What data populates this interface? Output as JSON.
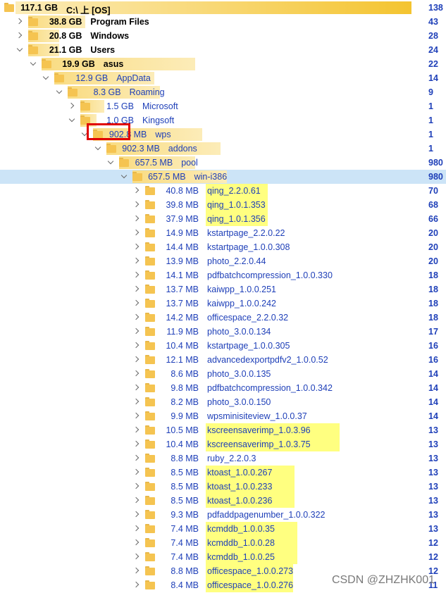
{
  "colors": {
    "bar": "#f9dc83",
    "bar_fade": "#fcecb8",
    "selection": "#cce4f7",
    "highlight": "#ffff80",
    "text_blue": "#1e3fb8",
    "annotation_red": "#e00000"
  },
  "icons": {
    "folder": "folder-icon",
    "expand": "chevron-right-icon",
    "collapse": "chevron-down-icon"
  },
  "watermark": "CSDN @ZHZHK001",
  "rows": [
    {
      "size": "117.1 GB",
      "name": "C:\\  上  [OS]",
      "right": "138",
      "depth": 0,
      "expanded": true,
      "bold": true,
      "bar": 1.0
    },
    {
      "size": "38.8 GB",
      "name": "Program Files",
      "right": "43",
      "depth": 1,
      "expanded": false,
      "bold": true,
      "bar": 0.33
    },
    {
      "size": "20.8 GB",
      "name": "Windows",
      "right": "28",
      "depth": 1,
      "expanded": false,
      "bold": true,
      "bar": 0.18
    },
    {
      "size": "21.1 GB",
      "name": "Users",
      "right": "24",
      "depth": 1,
      "expanded": true,
      "bold": true,
      "bar": 0.18
    },
    {
      "size": "19.9 GB",
      "name": "asus",
      "right": "22",
      "depth": 2,
      "expanded": true,
      "bold": true,
      "bar": 0.94
    },
    {
      "size": "12.9 GB",
      "name": "AppData",
      "right": "14",
      "depth": 3,
      "expanded": true,
      "bold": false,
      "bar": 0.65
    },
    {
      "size": "8.3 GB",
      "name": "Roaming",
      "right": "9",
      "depth": 4,
      "expanded": true,
      "bold": false,
      "bar": 0.64
    },
    {
      "size": "1.5 GB",
      "name": "Microsoft",
      "right": "1",
      "depth": 5,
      "expanded": false,
      "bold": false,
      "bar": 0.18
    },
    {
      "size": "1.0 GB",
      "name": "Kingsoft",
      "right": "1",
      "depth": 5,
      "expanded": true,
      "bold": false,
      "bar": 0.12
    },
    {
      "size": "902.8 MB",
      "name": "wps",
      "right": "1",
      "depth": 6,
      "expanded": true,
      "bold": false,
      "bar": 0.88
    },
    {
      "size": "902.3 MB",
      "name": "addons",
      "right": "1",
      "depth": 7,
      "expanded": true,
      "bold": false,
      "bar": 1.0
    },
    {
      "size": "657.5 MB",
      "name": "pool",
      "right": "980",
      "depth": 8,
      "expanded": true,
      "bold": false,
      "bar": 0.73
    },
    {
      "size": "657.5 MB",
      "name": "win-i386",
      "right": "980",
      "depth": 9,
      "expanded": true,
      "bold": false,
      "bar": 1.0,
      "selected": true
    },
    {
      "size": "40.8 MB",
      "name": "qing_2.2.0.61",
      "right": "70",
      "depth": 10,
      "expanded": false,
      "bar": 0,
      "hl": 88
    },
    {
      "size": "39.8 MB",
      "name": "qing_1.0.1.353",
      "right": "68",
      "depth": 10,
      "expanded": false,
      "bar": 0,
      "hl": 88
    },
    {
      "size": "37.9 MB",
      "name": "qing_1.0.1.356",
      "right": "66",
      "depth": 10,
      "expanded": false,
      "bar": 0,
      "hl": 88
    },
    {
      "size": "14.9 MB",
      "name": "kstartpage_2.2.0.22",
      "right": "20",
      "depth": 10,
      "expanded": false,
      "bar": 0
    },
    {
      "size": "14.4 MB",
      "name": "kstartpage_1.0.0.308",
      "right": "20",
      "depth": 10,
      "expanded": false,
      "bar": 0
    },
    {
      "size": "13.9 MB",
      "name": "photo_2.2.0.44",
      "right": "20",
      "depth": 10,
      "expanded": false,
      "bar": 0
    },
    {
      "size": "14.1 MB",
      "name": "pdfbatchcompression_1.0.0.330",
      "right": "18",
      "depth": 10,
      "expanded": false,
      "bar": 0
    },
    {
      "size": "13.7 MB",
      "name": "kaiwpp_1.0.0.251",
      "right": "18",
      "depth": 10,
      "expanded": false,
      "bar": 0
    },
    {
      "size": "13.7 MB",
      "name": "kaiwpp_1.0.0.242",
      "right": "18",
      "depth": 10,
      "expanded": false,
      "bar": 0
    },
    {
      "size": "14.2 MB",
      "name": "officespace_2.2.0.32",
      "right": "18",
      "depth": 10,
      "expanded": false,
      "bar": 0
    },
    {
      "size": "11.9 MB",
      "name": "photo_3.0.0.134",
      "right": "17",
      "depth": 10,
      "expanded": false,
      "bar": 0
    },
    {
      "size": "10.4 MB",
      "name": "kstartpage_1.0.0.305",
      "right": "16",
      "depth": 10,
      "expanded": false,
      "bar": 0
    },
    {
      "size": "12.1 MB",
      "name": "advancedexportpdfv2_1.0.0.52",
      "right": "16",
      "depth": 10,
      "expanded": false,
      "bar": 0
    },
    {
      "size": "8.6 MB",
      "name": "photo_3.0.0.135",
      "right": "14",
      "depth": 10,
      "expanded": false,
      "bar": 0
    },
    {
      "size": "9.8 MB",
      "name": "pdfbatchcompression_1.0.0.342",
      "right": "14",
      "depth": 10,
      "expanded": false,
      "bar": 0
    },
    {
      "size": "8.2 MB",
      "name": "photo_3.0.0.150",
      "right": "14",
      "depth": 10,
      "expanded": false,
      "bar": 0
    },
    {
      "size": "9.9 MB",
      "name": "wpsminisiteview_1.0.0.37",
      "right": "14",
      "depth": 10,
      "expanded": false,
      "bar": 0
    },
    {
      "size": "10.5 MB",
      "name": "kscreensaverimp_1.0.3.96",
      "right": "13",
      "depth": 10,
      "expanded": false,
      "bar": 0,
      "hl": 190
    },
    {
      "size": "10.4 MB",
      "name": "kscreensaverimp_1.0.3.75",
      "right": "13",
      "depth": 10,
      "expanded": false,
      "bar": 0,
      "hl": 190
    },
    {
      "size": "8.8 MB",
      "name": "ruby_2.2.0.3",
      "right": "13",
      "depth": 10,
      "expanded": false,
      "bar": 0
    },
    {
      "size": "8.5 MB",
      "name": "ktoast_1.0.0.267",
      "right": "13",
      "depth": 10,
      "expanded": false,
      "bar": 0,
      "hl": 126
    },
    {
      "size": "8.5 MB",
      "name": "ktoast_1.0.0.233",
      "right": "13",
      "depth": 10,
      "expanded": false,
      "bar": 0,
      "hl": 126
    },
    {
      "size": "8.5 MB",
      "name": "ktoast_1.0.0.236",
      "right": "13",
      "depth": 10,
      "expanded": false,
      "bar": 0,
      "hl": 126
    },
    {
      "size": "9.3 MB",
      "name": "pdfaddpagenumber_1.0.0.322",
      "right": "13",
      "depth": 10,
      "expanded": false,
      "bar": 0
    },
    {
      "size": "7.4 MB",
      "name": "kcmddb_1.0.0.35",
      "right": "13",
      "depth": 10,
      "expanded": false,
      "bar": 0,
      "hl": 130
    },
    {
      "size": "7.4 MB",
      "name": "kcmddb_1.0.0.28",
      "right": "12",
      "depth": 10,
      "expanded": false,
      "bar": 0,
      "hl": 130
    },
    {
      "size": "7.4 MB",
      "name": "kcmddb_1.0.0.25",
      "right": "12",
      "depth": 10,
      "expanded": false,
      "bar": 0,
      "hl": 130
    },
    {
      "size": "8.8 MB",
      "name": "officespace_1.0.0.273",
      "right": "12",
      "depth": 10,
      "expanded": false,
      "bar": 0,
      "hl": 124
    },
    {
      "size": "8.4 MB",
      "name": "officespace_1.0.0.276",
      "right": "11",
      "depth": 10,
      "expanded": false,
      "bar": 0,
      "hl": 124
    }
  ]
}
